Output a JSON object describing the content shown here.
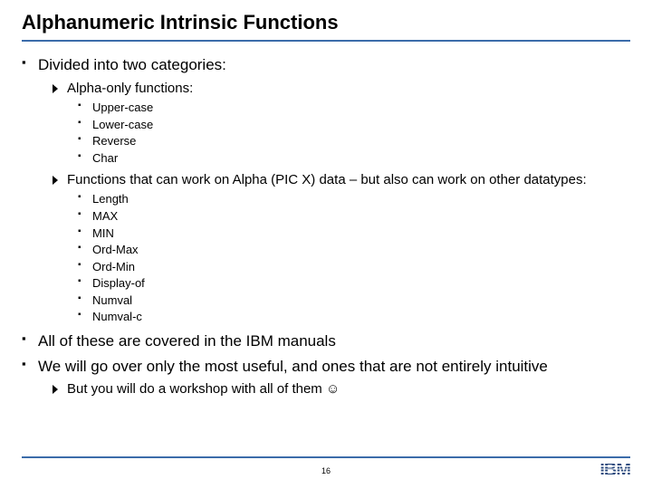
{
  "title": "Alphanumeric Intrinsic Functions",
  "bullets": {
    "b1": "Divided into two categories:",
    "b1a": "Alpha-only functions:",
    "b1a_items": [
      "Upper-case",
      "Lower-case",
      "Reverse",
      "Char"
    ],
    "b1b": "Functions that can work on Alpha (PIC X) data – but also can work on other datatypes:",
    "b1b_items": [
      "Length",
      "MAX",
      "MIN",
      "Ord-Max",
      "Ord-Min",
      "Display-of",
      "Numval",
      "Numval-c"
    ],
    "b2": "All of these are covered in the IBM manuals",
    "b3": "We will go over only the most useful, and ones that are not entirely intuitive",
    "b3a": "But you will do a workshop with all of them ☺"
  },
  "page_number": "16",
  "logo_text": "IBM"
}
